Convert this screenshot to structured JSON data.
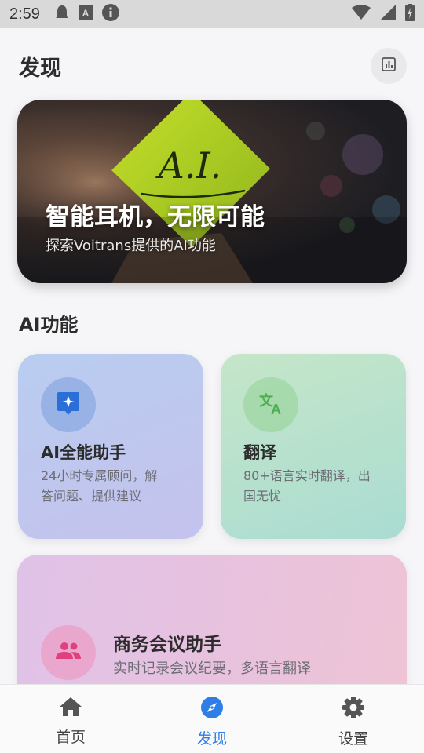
{
  "status_bar": {
    "time": "2:59"
  },
  "header": {
    "title": "发现",
    "stats_icon": "bar-chart-icon"
  },
  "hero": {
    "sign_text": "A.I.",
    "title": "智能耳机，无限可能",
    "subtitle": "探索Voitrans提供的AI功能"
  },
  "section": {
    "title": "AI功能"
  },
  "cards": [
    {
      "title": "AI全能助手",
      "desc_line1": "24小时专属顾问，解",
      "desc_line2": "答问题、提供建议",
      "icon": "ai-sparkle-icon"
    },
    {
      "title": "翻译",
      "desc_line1": "80+语言实时翻译，出",
      "desc_line2": "国无忧",
      "icon": "translate-icon"
    },
    {
      "title": "商务会议助手",
      "desc": "实时记录会议纪要，多语言翻译",
      "icon": "people-icon"
    }
  ],
  "nav": [
    {
      "label": "首页",
      "icon": "home-icon",
      "active": false
    },
    {
      "label": "发现",
      "icon": "compass-icon",
      "active": true
    },
    {
      "label": "设置",
      "icon": "gear-icon",
      "active": false
    }
  ],
  "colors": {
    "accent": "#2f7ee8",
    "ai_icon": "#2a6fd8",
    "translate_icon": "#4caf50",
    "people_icon": "#e0407e"
  }
}
